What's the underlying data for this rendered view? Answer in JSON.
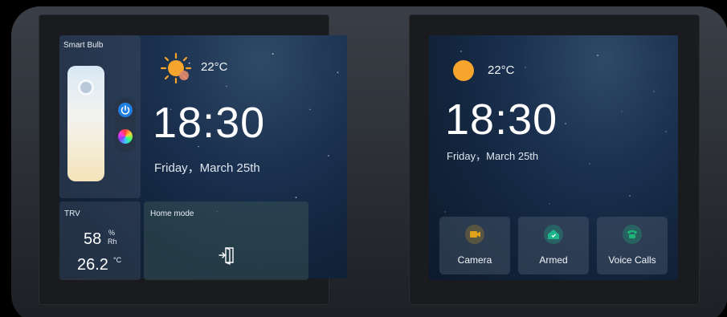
{
  "left_panel": {
    "smart_bulb": {
      "title": "Smart Bulb",
      "brightness": 1.0
    },
    "weather": {
      "temp": "22°C",
      "icon": "sun-cloud-icon"
    },
    "clock": {
      "time": "18:30",
      "date": "Friday，March 25th"
    },
    "trv": {
      "title": "TRV",
      "humidity_value": "58",
      "humidity_unit_top": "%",
      "humidity_unit_bottom": "Rh",
      "temperature_value": "26.2",
      "temperature_unit": "°C"
    },
    "home_mode": {
      "title": "Home mode",
      "icon": "door-exit-icon"
    }
  },
  "right_panel": {
    "weather": {
      "temp": "22°C",
      "icon": "sun-icon"
    },
    "clock": {
      "time": "18:30",
      "date": "Friday，March 25th"
    },
    "tiles": [
      {
        "label": "Camera",
        "icon": "camera-icon",
        "color": "#e0a21a"
      },
      {
        "label": "Armed",
        "icon": "home-shield-icon",
        "color": "#1fb58a"
      },
      {
        "label": "Voice Calls",
        "icon": "phone-icon",
        "color": "#1fb57a"
      }
    ]
  },
  "colors": {
    "power_blue": "#1f7fe0",
    "sun_orange": "#f6a52c"
  }
}
